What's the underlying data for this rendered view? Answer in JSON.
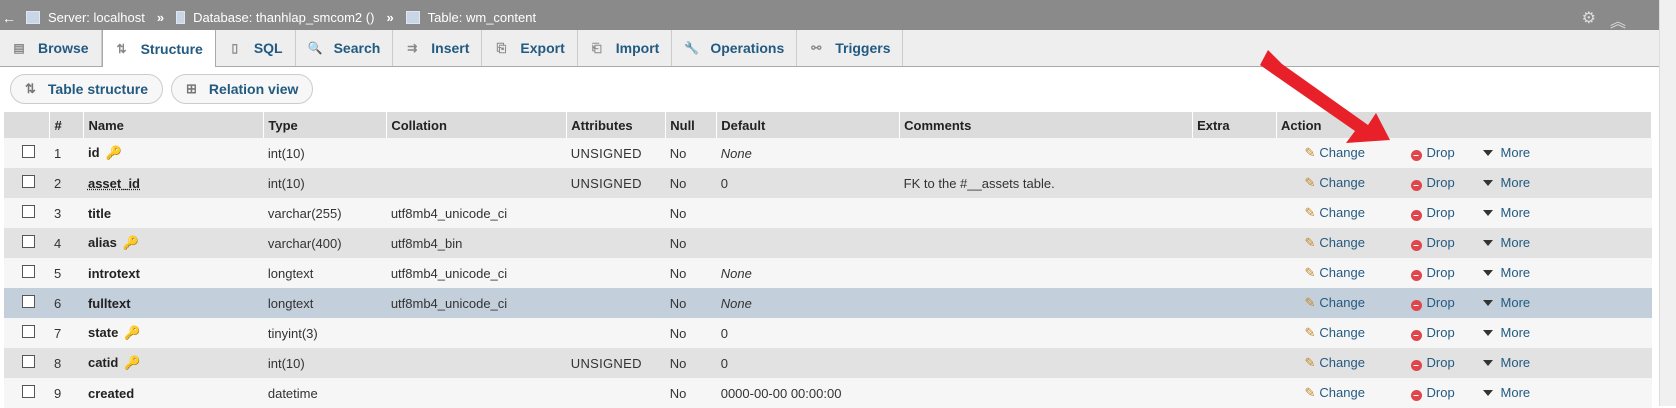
{
  "breadcrumb": {
    "back": "←",
    "items": [
      "Server: localhost",
      "Database: thanhlap_smcom2 ()",
      "Table: wm_content"
    ],
    "separator": "»"
  },
  "tabs": [
    {
      "label": "Browse",
      "icon": "browse-icon",
      "glyph": "▤",
      "active": false
    },
    {
      "label": "Structure",
      "icon": "structure-icon",
      "glyph": "⇅",
      "active": true
    },
    {
      "label": "SQL",
      "icon": "sql-icon",
      "glyph": "▯",
      "active": false
    },
    {
      "label": "Search",
      "icon": "search-icon",
      "glyph": "🔍",
      "active": false
    },
    {
      "label": "Insert",
      "icon": "insert-icon",
      "glyph": "⇉",
      "active": false
    },
    {
      "label": "Export",
      "icon": "export-icon",
      "glyph": "⎘",
      "active": false
    },
    {
      "label": "Import",
      "icon": "import-icon",
      "glyph": "⎗",
      "active": false
    },
    {
      "label": "Operations",
      "icon": "wrench-icon",
      "glyph": "🔧",
      "active": false
    },
    {
      "label": "Triggers",
      "icon": "triggers-icon",
      "glyph": "⚯",
      "active": false
    }
  ],
  "subnav": {
    "table_structure": "Table structure",
    "relation_view": "Relation view"
  },
  "columns": [
    "",
    "#",
    "Name",
    "Type",
    "Collation",
    "Attributes",
    "Null",
    "Default",
    "Comments",
    "Extra",
    "Action"
  ],
  "actions": {
    "change": "Change",
    "drop": "Drop",
    "more": "More"
  },
  "rows": [
    {
      "num": "1",
      "name": "id",
      "type": "int(10)",
      "collation": "",
      "attributes": "UNSIGNED",
      "null": "No",
      "default": "None",
      "comments": "",
      "extra": "",
      "icon": "primary-key-icon"
    },
    {
      "num": "2",
      "name": "asset_id",
      "type": "int(10)",
      "collation": "",
      "attributes": "UNSIGNED",
      "null": "No",
      "default": "0",
      "comments": "FK to the #__assets table.",
      "extra": "",
      "icon": ""
    },
    {
      "num": "3",
      "name": "title",
      "type": "varchar(255)",
      "collation": "utf8mb4_unicode_ci",
      "attributes": "",
      "null": "No",
      "default": "",
      "comments": "",
      "extra": "",
      "icon": ""
    },
    {
      "num": "4",
      "name": "alias",
      "type": "varchar(400)",
      "collation": "utf8mb4_bin",
      "attributes": "",
      "null": "No",
      "default": "",
      "comments": "",
      "extra": "",
      "icon": "index-key-icon"
    },
    {
      "num": "5",
      "name": "introtext",
      "type": "longtext",
      "collation": "utf8mb4_unicode_ci",
      "attributes": "",
      "null": "No",
      "default": "None",
      "comments": "",
      "extra": "",
      "icon": ""
    },
    {
      "num": "6",
      "name": "fulltext",
      "type": "longtext",
      "collation": "utf8mb4_unicode_ci",
      "attributes": "",
      "null": "No",
      "default": "None",
      "comments": "",
      "extra": "",
      "icon": ""
    },
    {
      "num": "7",
      "name": "state",
      "type": "tinyint(3)",
      "collation": "",
      "attributes": "",
      "null": "No",
      "default": "0",
      "comments": "",
      "extra": "",
      "icon": "index-key-icon"
    },
    {
      "num": "8",
      "name": "catid",
      "type": "int(10)",
      "collation": "",
      "attributes": "UNSIGNED",
      "null": "No",
      "default": "0",
      "comments": "",
      "extra": "",
      "icon": "index-key-icon"
    },
    {
      "num": "9",
      "name": "created",
      "type": "datetime",
      "collation": "",
      "attributes": "",
      "null": "No",
      "default": "0000-00-00 00:00:00",
      "comments": "",
      "extra": "",
      "icon": ""
    }
  ],
  "colors": {
    "link": "#235a81",
    "arrow": "#e8202a",
    "highlight_row": "#c4cfdc"
  }
}
